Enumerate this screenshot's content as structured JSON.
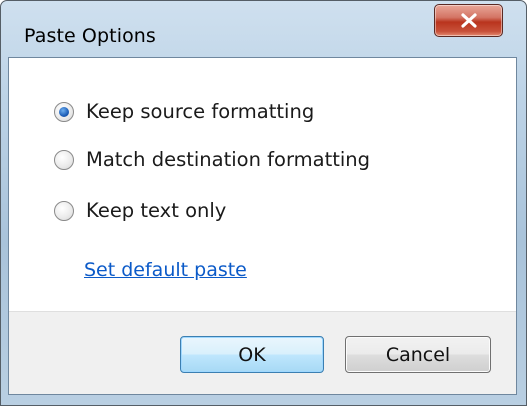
{
  "window": {
    "title": "Paste Options"
  },
  "options": [
    {
      "label": "Keep source formatting",
      "checked": true
    },
    {
      "label": "Match destination formatting",
      "checked": false
    },
    {
      "label": "Keep text only",
      "checked": false
    }
  ],
  "link": {
    "label": "Set default paste"
  },
  "buttons": {
    "ok_label": "OK",
    "cancel_label": "Cancel"
  },
  "colors": {
    "link": "#0b5ac8",
    "close_button": "#c8513a",
    "radio_selected": "#1e5fb8"
  },
  "icons": {
    "close": "close-icon"
  }
}
